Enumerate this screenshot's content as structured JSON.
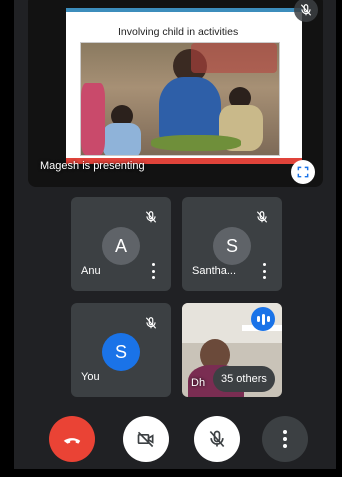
{
  "presentation": {
    "slide_title": "Involving child in activities",
    "presenter_label": "Magesh is presenting",
    "fullscreen_icon": "fullscreen-icon",
    "mic_icon": "mic-off-icon"
  },
  "participants": [
    {
      "name": "Anu",
      "initial": "A",
      "avatar_color": "#5f6368",
      "muted": true
    },
    {
      "name": "Santha...",
      "initial": "S",
      "avatar_color": "#5f6368",
      "muted": true
    },
    {
      "name": "You",
      "initial": "S",
      "avatar_color": "#1a73e8",
      "muted": true
    },
    {
      "name": "Dh",
      "initial": "",
      "avatar_color": "",
      "muted": false,
      "speaking": true
    }
  ],
  "others_label": "35 others",
  "controls": {
    "leave_icon": "end-call-icon",
    "camera_icon": "camera-off-icon",
    "mic_icon": "mic-off-icon",
    "more_icon": "more-vert-icon"
  },
  "colors": {
    "background": "#202124",
    "tile": "#3c4043",
    "leave": "#ea4335",
    "accent": "#1a73e8"
  }
}
